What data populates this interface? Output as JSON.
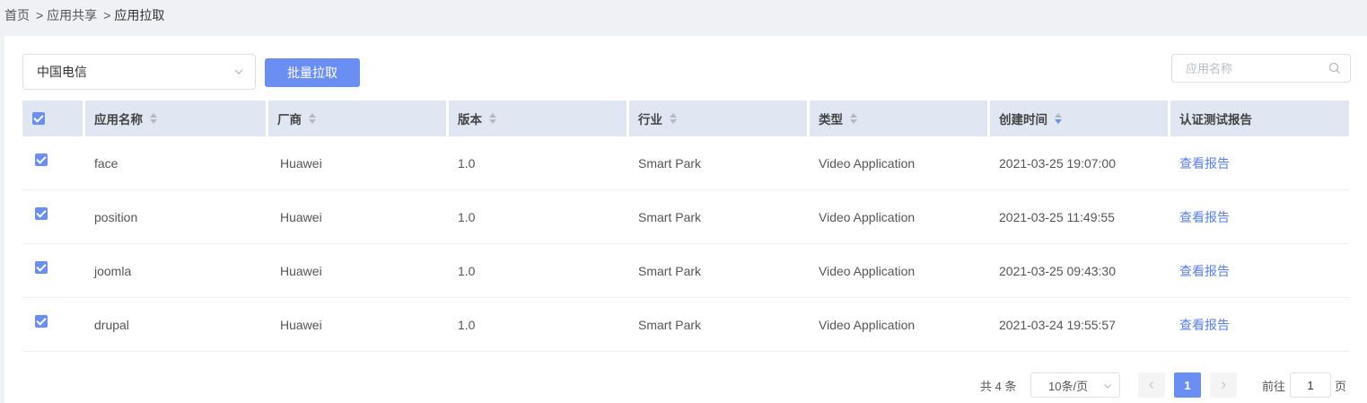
{
  "breadcrumb": {
    "items": [
      "首页",
      "应用共享",
      "应用拉取"
    ],
    "separator": ">"
  },
  "toolbar": {
    "operator_select": "中国电信",
    "batch_pull_label": "批量拉取",
    "search_placeholder": "应用名称"
  },
  "table": {
    "columns": [
      "应用名称",
      "厂商",
      "版本",
      "行业",
      "类型",
      "创建时间",
      "认证测试报告"
    ],
    "rows": [
      {
        "name": "face",
        "vendor": "Huawei",
        "version": "1.0",
        "industry": "Smart Park",
        "type": "Video Application",
        "created": "2021-03-25 19:07:00",
        "report": "查看报告"
      },
      {
        "name": "position",
        "vendor": "Huawei",
        "version": "1.0",
        "industry": "Smart Park",
        "type": "Video Application",
        "created": "2021-03-25 11:49:55",
        "report": "查看报告"
      },
      {
        "name": "joomla",
        "vendor": "Huawei",
        "version": "1.0",
        "industry": "Smart Park",
        "type": "Video Application",
        "created": "2021-03-25 09:43:30",
        "report": "查看报告"
      },
      {
        "name": "drupal",
        "vendor": "Huawei",
        "version": "1.0",
        "industry": "Smart Park",
        "type": "Video Application",
        "created": "2021-03-24 19:55:57",
        "report": "查看报告"
      }
    ]
  },
  "pagination": {
    "total_label": "共 4 条",
    "page_size": "10条/页",
    "current_page": "1",
    "goto_label": "前往",
    "goto_value": "1",
    "page_unit": "页"
  },
  "colors": {
    "primary": "#6b8ef2",
    "header_bg": "#e1e6f3",
    "link": "#5a7fe6"
  }
}
